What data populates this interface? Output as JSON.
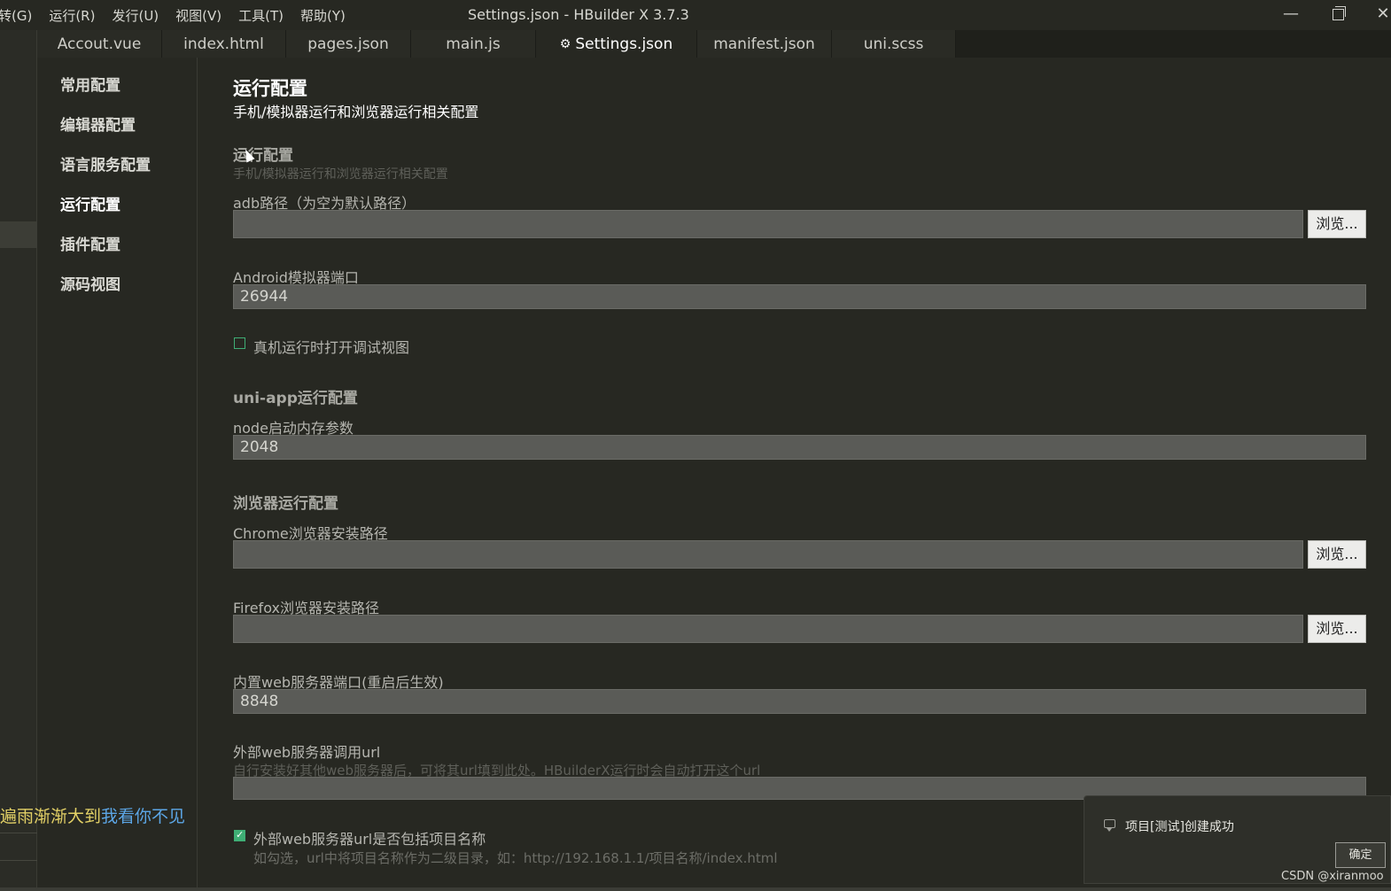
{
  "window": {
    "title": "Settings.json - HBuilder X 3.7.3",
    "menu": [
      "转(G)",
      "运行(R)",
      "发行(U)",
      "视图(V)",
      "工具(T)",
      "帮助(Y)"
    ],
    "minimize": "—",
    "close": "✕"
  },
  "tabs": [
    {
      "label": "Accout.vue"
    },
    {
      "label": "index.html"
    },
    {
      "label": "pages.json"
    },
    {
      "label": "main.js"
    },
    {
      "label": "Settings.json",
      "icon": "gear-icon",
      "active": true
    },
    {
      "label": "manifest.json"
    },
    {
      "label": "uni.scss"
    }
  ],
  "nav": {
    "items": [
      {
        "label": "常用配置"
      },
      {
        "label": "编辑器配置"
      },
      {
        "label": "语言服务配置"
      },
      {
        "label": "运行配置",
        "active": true
      },
      {
        "label": "插件配置"
      },
      {
        "label": "源码视图"
      }
    ]
  },
  "content": {
    "title": "运行配置",
    "subtitle": "手机/模拟器运行和浏览器运行相关配置",
    "run_section": {
      "title": "运行配置",
      "hint": "手机/模拟器运行和浏览器运行相关配置"
    },
    "adb_path": {
      "label": "adb路径（为空为默认路径）",
      "value": "",
      "browse": "浏览..."
    },
    "android_port": {
      "label": "Android模拟器端口",
      "value": "26944"
    },
    "debug_view": {
      "label": "真机运行时打开调试视图",
      "checked": false
    },
    "uniapp_section": {
      "title": "uni-app运行配置"
    },
    "node_memory": {
      "label": "node启动内存参数",
      "value": "2048"
    },
    "browser_section": {
      "title": "浏览器运行配置"
    },
    "chrome_path": {
      "label": "Chrome浏览器安装路径",
      "value": "",
      "browse": "浏览..."
    },
    "firefox_path": {
      "label": "Firefox浏览器安装路径",
      "value": "",
      "browse": "浏览..."
    },
    "web_port": {
      "label": "内置web服务器端口(重启后生效)",
      "value": "8848"
    },
    "external_url": {
      "label": "外部web服务器调用url",
      "hint": "自行安装好其他web服务器后，可将其url填到此处。HBuilderX运行时会自动打开这个url",
      "value": ""
    },
    "include_project": {
      "label": "外部web服务器url是否包括项目名称",
      "hint": "如勾选，url中将项目名称作为二级目录，如：http://192.168.1.1/项目名称/index.html",
      "checked": true
    }
  },
  "lyrics": {
    "part_a": "遍雨渐渐大到",
    "part_b": "我看你不见"
  },
  "toast": {
    "message": "项目[测试]创建成功",
    "ok": "确定"
  },
  "watermark": "CSDN @xiranmoo",
  "colors": {
    "background": "#272822",
    "accent_green": "#3fae75",
    "input_bg": "#5a5b57"
  }
}
